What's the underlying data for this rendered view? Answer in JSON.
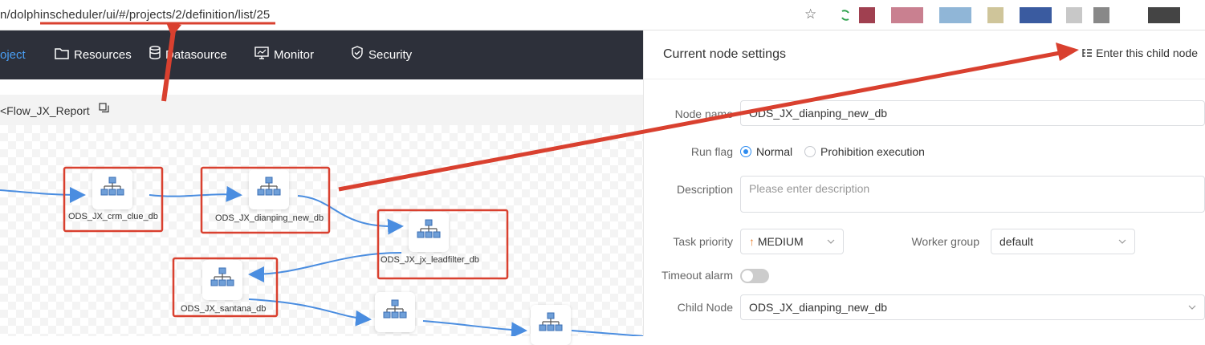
{
  "browser": {
    "url": "n/dolphinscheduler/ui/#/projects/2/definition/list/25",
    "extension_colors": [
      "#2ea24d",
      "#a04050",
      "#c98090",
      "#6b9ec9",
      "#cfc59a",
      "#3a5ba0",
      "#c8c8c8",
      "#888888",
      "#444444"
    ]
  },
  "nav": {
    "items": [
      {
        "label": "oject",
        "icon": "project-icon"
      },
      {
        "label": "Resources",
        "icon": "folder-icon"
      },
      {
        "label": "Datasource",
        "icon": "database-icon"
      },
      {
        "label": "Monitor",
        "icon": "monitor-icon"
      },
      {
        "label": "Security",
        "icon": "shield-icon"
      }
    ],
    "active_color": "#4a9ff5"
  },
  "breadcrumb": {
    "text": "<Flow_JX_Report"
  },
  "dag": {
    "nodes": [
      {
        "label": "ODS_JX_crm_clue_db"
      },
      {
        "label": "ODS_JX_dianping_new_db"
      },
      {
        "label": "ODS_JX_jx_leadfilter_db"
      },
      {
        "label": "ODS_JX_santana_db"
      },
      {
        "label": ""
      },
      {
        "label": ""
      }
    ],
    "edge_color": "#4a8de0",
    "highlight_color": "#d9402f"
  },
  "panel": {
    "title": "Current node settings",
    "enter_child_label": "Enter this child node",
    "node_name_label": "Node name",
    "node_name_value": "ODS_JX_dianping_new_db",
    "run_flag_label": "Run flag",
    "run_flag_options": [
      "Normal",
      "Prohibition execution"
    ],
    "run_flag_selected": "Normal",
    "description_label": "Description",
    "description_placeholder": "Please enter description",
    "priority_label": "Task priority",
    "priority_value": "MEDIUM",
    "priority_color": "#e8812f",
    "worker_group_label": "Worker group",
    "worker_group_value": "default",
    "timeout_label": "Timeout alarm",
    "timeout_on": false,
    "child_node_label": "Child Node",
    "child_node_value": "ODS_JX_dianping_new_db"
  }
}
